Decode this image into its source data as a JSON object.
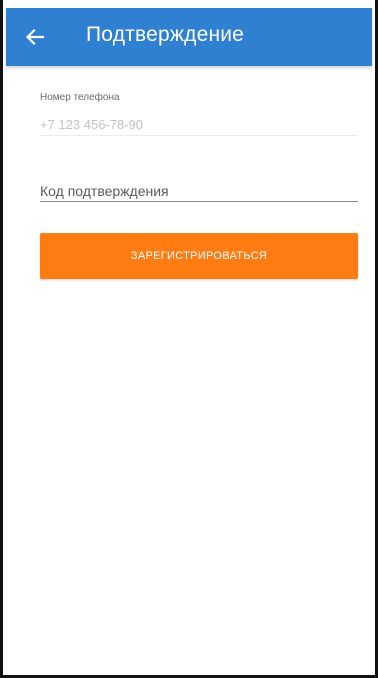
{
  "app_bar": {
    "back_icon": "arrow-left-icon",
    "title": "Подтверждение",
    "background_color": "#2f80d0"
  },
  "phone_field": {
    "label": "Номер телефона",
    "value": "+7 123 456-78-90"
  },
  "code_field": {
    "placeholder": "Код подтверждения",
    "value": ""
  },
  "register_button": {
    "label": "ЗАРЕГИСТРИРОВАТЬСЯ",
    "background_color": "#ff7c12"
  }
}
